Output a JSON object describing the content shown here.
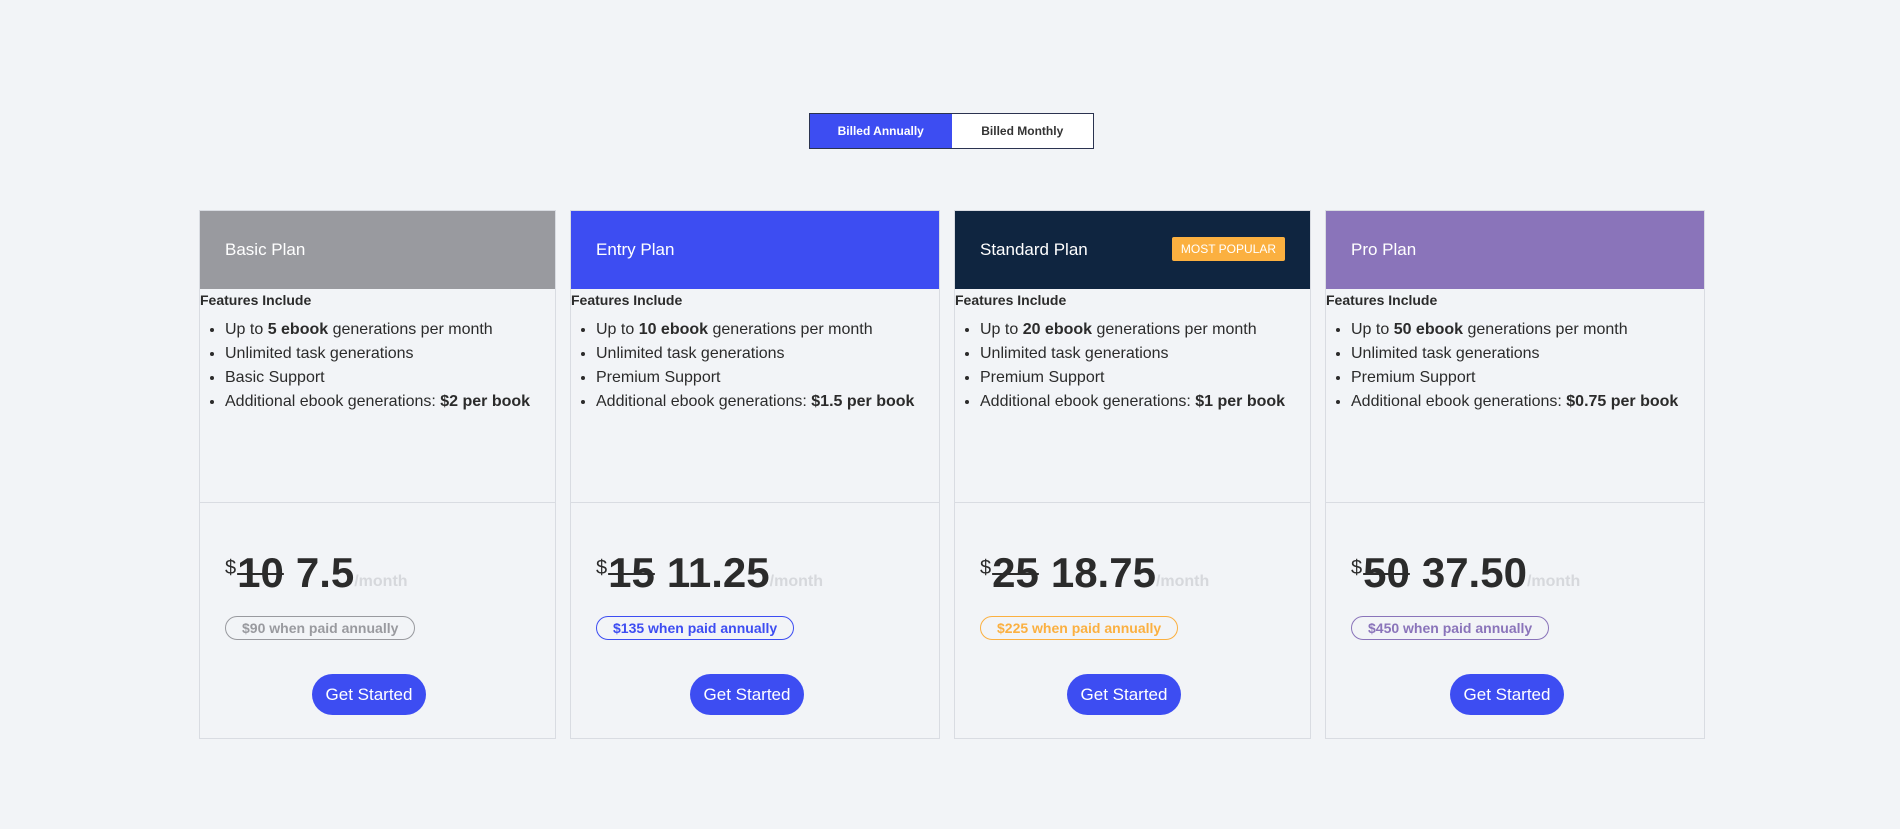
{
  "toggle": {
    "annual_label": "Billed Annually",
    "monthly_label": "Billed Monthly",
    "active": "annual"
  },
  "plans": [
    {
      "name": "Basic Plan",
      "header_color": "#999a9f",
      "badge": "",
      "features_title": "Features Include",
      "features": [
        {
          "pre": "Up to ",
          "bold": "5 ebook",
          "post": " generations per month"
        },
        {
          "pre": "Unlimited task generations",
          "bold": "",
          "post": ""
        },
        {
          "pre": "Basic Support",
          "bold": "",
          "post": ""
        },
        {
          "pre": "Additional ebook generations: ",
          "bold": "$2 per book",
          "post": ""
        }
      ],
      "currency": "$",
      "old_price": "10",
      "new_price": "7.5",
      "per": "/month",
      "annual_text": "$90 when paid annually",
      "annual_color": "#999a9f",
      "cta": "Get Started"
    },
    {
      "name": "Entry Plan",
      "header_color": "#3d4df2",
      "badge": "",
      "features_title": "Features Include",
      "features": [
        {
          "pre": "Up to ",
          "bold": "10 ebook",
          "post": " generations per month"
        },
        {
          "pre": "Unlimited task generations",
          "bold": "",
          "post": ""
        },
        {
          "pre": "Premium Support",
          "bold": "",
          "post": ""
        },
        {
          "pre": "Additional ebook generations: ",
          "bold": "$1.5 per book",
          "post": ""
        }
      ],
      "currency": "$",
      "old_price": "15",
      "new_price": "11.25",
      "per": "/month",
      "annual_text": "$135 when paid annually",
      "annual_color": "#3d4df2",
      "cta": "Get Started"
    },
    {
      "name": "Standard Plan",
      "header_color": "#0f2540",
      "badge": "MOST POPULAR",
      "features_title": "Features Include",
      "features": [
        {
          "pre": "Up to ",
          "bold": "20 ebook",
          "post": " generations per month"
        },
        {
          "pre": "Unlimited task generations",
          "bold": "",
          "post": ""
        },
        {
          "pre": "Premium Support",
          "bold": "",
          "post": ""
        },
        {
          "pre": "Additional ebook generations: ",
          "bold": "$1 per book",
          "post": ""
        }
      ],
      "currency": "$",
      "old_price": "25",
      "new_price": "18.75",
      "per": "/month",
      "annual_text": "$225 when paid annually",
      "annual_color": "#fbb040",
      "cta": "Get Started"
    },
    {
      "name": "Pro Plan",
      "header_color": "#8a74ba",
      "badge": "",
      "features_title": "Features Include",
      "features": [
        {
          "pre": "Up to ",
          "bold": "50 ebook",
          "post": " generations per month"
        },
        {
          "pre": "Unlimited task generations",
          "bold": "",
          "post": ""
        },
        {
          "pre": "Premium Support",
          "bold": "",
          "post": ""
        },
        {
          "pre": "Additional ebook generations: ",
          "bold": "$0.75 per book",
          "post": ""
        }
      ],
      "currency": "$",
      "old_price": "50",
      "new_price": "37.50",
      "per": "/month",
      "annual_text": "$450 when paid annually",
      "annual_color": "#8a74ba",
      "cta": "Get Started"
    }
  ]
}
